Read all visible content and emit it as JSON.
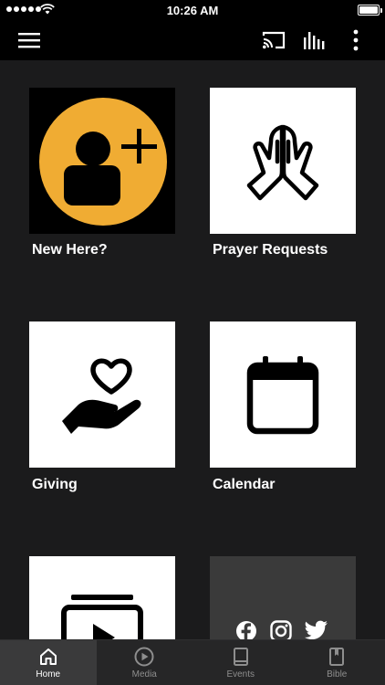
{
  "status_bar": {
    "time": "10:26 AM",
    "battery_level": 1.0
  },
  "app_bar": {
    "icons": [
      "menu-icon",
      "cast-icon",
      "audio-bars-icon",
      "more-vertical-icon"
    ]
  },
  "tiles": [
    {
      "label": "New Here?",
      "icon": "add-user-icon",
      "accent": "#f0ac33"
    },
    {
      "label": "Prayer Requests",
      "icon": "praying-hands-icon"
    },
    {
      "label": "Giving",
      "icon": "hand-heart-icon"
    },
    {
      "label": "Calendar",
      "icon": "calendar-icon"
    },
    {
      "label": "",
      "icon": "video-playlist-icon"
    },
    {
      "label": "",
      "icons": [
        "facebook-icon",
        "instagram-icon",
        "twitter-icon"
      ]
    }
  ],
  "tab_bar": {
    "tabs": [
      {
        "label": "Home",
        "icon": "home-icon",
        "active": true
      },
      {
        "label": "Media",
        "icon": "play-circle-icon",
        "active": false
      },
      {
        "label": "Events",
        "icon": "book-icon",
        "active": false
      },
      {
        "label": "Bible",
        "icon": "bookmark-book-icon",
        "active": false
      }
    ]
  },
  "colors": {
    "background": "#1b1b1c",
    "bar": "#000000",
    "tab_bar": "#262627",
    "accent": "#f0ac33"
  }
}
